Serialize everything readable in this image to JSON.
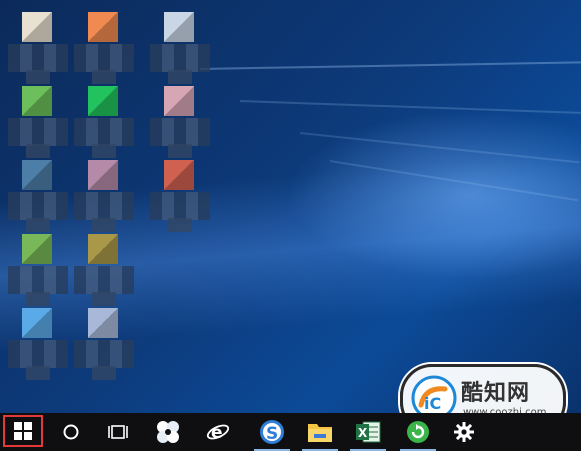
{
  "desktop": {
    "icons": [
      {
        "name": "desktop-icon-1",
        "color": "#e8e0d0"
      },
      {
        "name": "desktop-icon-2",
        "color": "#f08a50"
      },
      {
        "name": "desktop-icon-3",
        "color": "#c8d6e6"
      },
      {
        "name": "desktop-icon-4",
        "color": "#6cbf5a"
      },
      {
        "name": "desktop-icon-5",
        "color": "#22c35e"
      },
      {
        "name": "desktop-icon-6",
        "color": "#d7a6b5"
      },
      {
        "name": "desktop-icon-7",
        "color": "#4d7ea8"
      },
      {
        "name": "desktop-icon-8",
        "color": "#b48aa8"
      },
      {
        "name": "desktop-icon-9",
        "color": "#d06050"
      },
      {
        "name": "desktop-icon-10",
        "color": "#78b858"
      },
      {
        "name": "desktop-icon-11",
        "color": "#a89848"
      },
      {
        "name": "desktop-icon-12",
        "color": "#5aaae8"
      },
      {
        "name": "desktop-icon-13",
        "color": "#a8b8d8"
      }
    ]
  },
  "taskbar": {
    "background": "#0f0f12",
    "items": [
      {
        "name": "start-button",
        "icon": "windows-logo-icon",
        "highlight": "#e23a3a"
      },
      {
        "name": "cortana-button",
        "icon": "circle-search-icon"
      },
      {
        "name": "task-view-button",
        "icon": "task-view-icon"
      },
      {
        "name": "pinwheel-app-button",
        "icon": "pinwheel-icon"
      },
      {
        "name": "internet-explorer-button",
        "icon": "ie-icon"
      },
      {
        "name": "sogou-browser-button",
        "icon": "sogou-s-icon",
        "active": true
      },
      {
        "name": "file-explorer-button",
        "icon": "folder-icon",
        "active": true
      },
      {
        "name": "excel-button",
        "icon": "excel-icon",
        "active": true
      },
      {
        "name": "refresh-app-button",
        "icon": "green-refresh-icon",
        "active": true
      },
      {
        "name": "settings-button",
        "icon": "gear-icon"
      }
    ]
  },
  "watermark": {
    "title": "酷知网",
    "url": "www.coozhi.com"
  }
}
